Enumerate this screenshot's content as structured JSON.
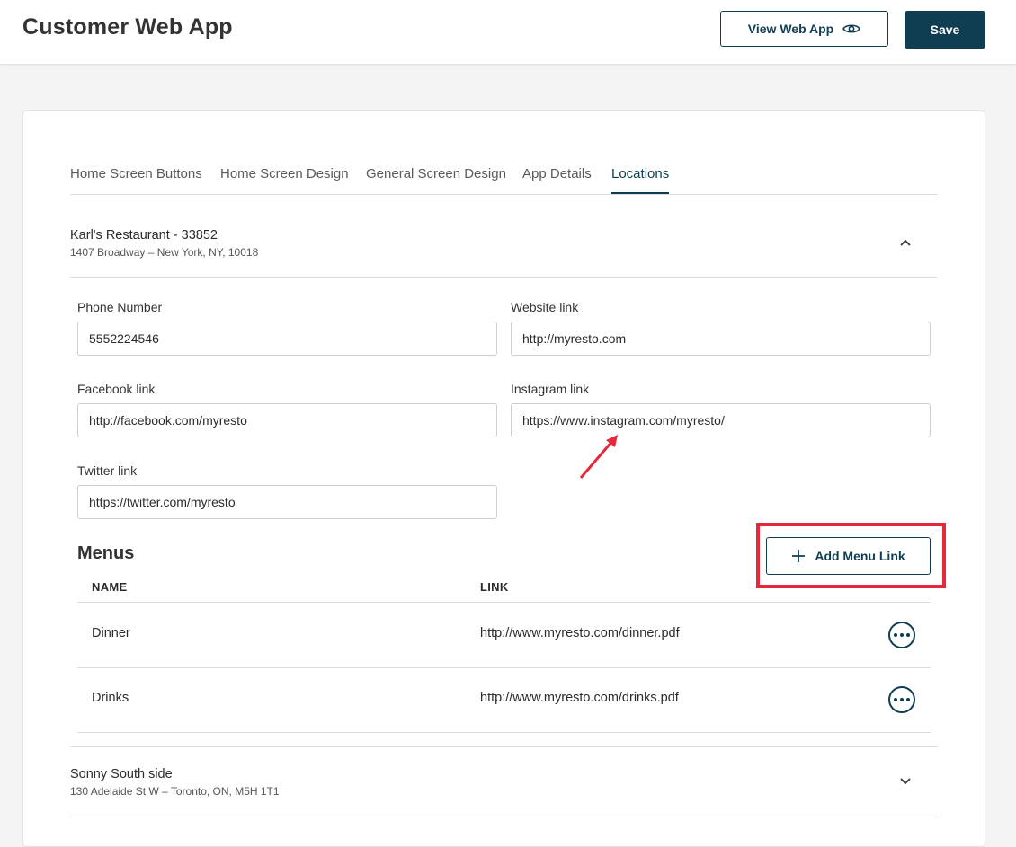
{
  "header": {
    "title": "Customer Web App",
    "view_label": "View Web App",
    "save_label": "Save"
  },
  "tabs": [
    {
      "label": "Home Screen Buttons"
    },
    {
      "label": "Home Screen Design"
    },
    {
      "label": "General Screen Design"
    },
    {
      "label": "App Details"
    },
    {
      "label": "Locations",
      "active": true
    }
  ],
  "locations": [
    {
      "name": "Karl's Restaurant - 33852",
      "address": "1407 Broadway – New York, NY, 10018",
      "expanded": true,
      "fields": {
        "phone": {
          "label": "Phone Number",
          "value": "5552224546"
        },
        "website": {
          "label": "Website link",
          "value": "http://myresto.com"
        },
        "facebook": {
          "label": "Facebook link",
          "value": "http://facebook.com/myresto"
        },
        "instagram": {
          "label": "Instagram link",
          "value": "https://www.instagram.com/myresto/"
        },
        "twitter": {
          "label": "Twitter link",
          "value": "https://twitter.com/myresto"
        }
      },
      "menus": {
        "title": "Menus",
        "add_label": "Add Menu Link",
        "columns": [
          "NAME",
          "LINK"
        ],
        "rows": [
          {
            "name": "Dinner",
            "link": "http://www.myresto.com/dinner.pdf"
          },
          {
            "name": "Drinks",
            "link": "http://www.myresto.com/drinks.pdf"
          }
        ]
      }
    },
    {
      "name": "Sonny South side",
      "address": "130 Adelaide St W – Toronto, ON, M5H 1T1",
      "expanded": false
    }
  ],
  "colors": {
    "accent": "#0f3d52",
    "annotation": "#e6283a",
    "background": "#f4f4f4"
  },
  "icons": {
    "view": "eye-icon",
    "add": "plus-icon",
    "more": "more-horizontal-icon",
    "collapse": "chevron-up-icon",
    "expand": "chevron-down-icon"
  }
}
